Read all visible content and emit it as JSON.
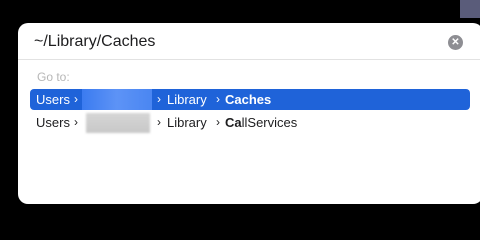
{
  "path_field": {
    "value": "~/Library/Caches"
  },
  "goto_label": "Go to:",
  "results": [
    {
      "seg1": "Users",
      "seg2": "Library",
      "seg3_bold": "Caches",
      "seg3_rest": ""
    },
    {
      "seg1": "Users",
      "seg2": "Library",
      "seg3_bold": "Ca",
      "seg3_rest": "llServices"
    }
  ],
  "icons": {
    "clear": "clear-circle-icon",
    "separator": "chevron-right-icon"
  },
  "colors": {
    "selection": "#1f63d9",
    "background": "#000000"
  }
}
